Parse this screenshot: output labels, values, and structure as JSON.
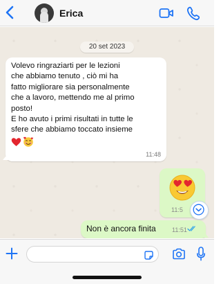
{
  "header": {
    "contact_name": "Erica"
  },
  "chat": {
    "date_label": "20 set 2023",
    "incoming_message": {
      "text": "Volevo ringraziarti per le lezioni\nche abbiamo tenuto , ciò mi ha\nfatto migliorare sia personalmente\nche a lavoro, mettendo me al primo\nposto!\nE ho avuto i primi risultati in tutte le\nsfere che abbiamo toccato insieme",
      "emojis": [
        "heart-emoji",
        "smiling-face-with-hearts-emoji"
      ],
      "time": "11:48"
    },
    "outgoing_emoji_message": {
      "emoji": "heart-eyes-emoji",
      "time": "11:5"
    },
    "outgoing_text_message": {
      "text": "Non è ancora finita",
      "time": "11:51",
      "status": "read-double-check"
    }
  },
  "input": {
    "placeholder": ""
  },
  "colors": {
    "accent": "#1e74f5",
    "incoming_bubble": "#ffffff",
    "outgoing_bubble": "#dcf8c6",
    "chat_background": "#efeae2",
    "read_check": "#34a5e9"
  },
  "icons": [
    "back-icon",
    "video-call-icon",
    "phone-icon",
    "scroll-down-icon",
    "plus-icon",
    "sticker-icon",
    "camera-icon",
    "microphone-icon"
  ]
}
